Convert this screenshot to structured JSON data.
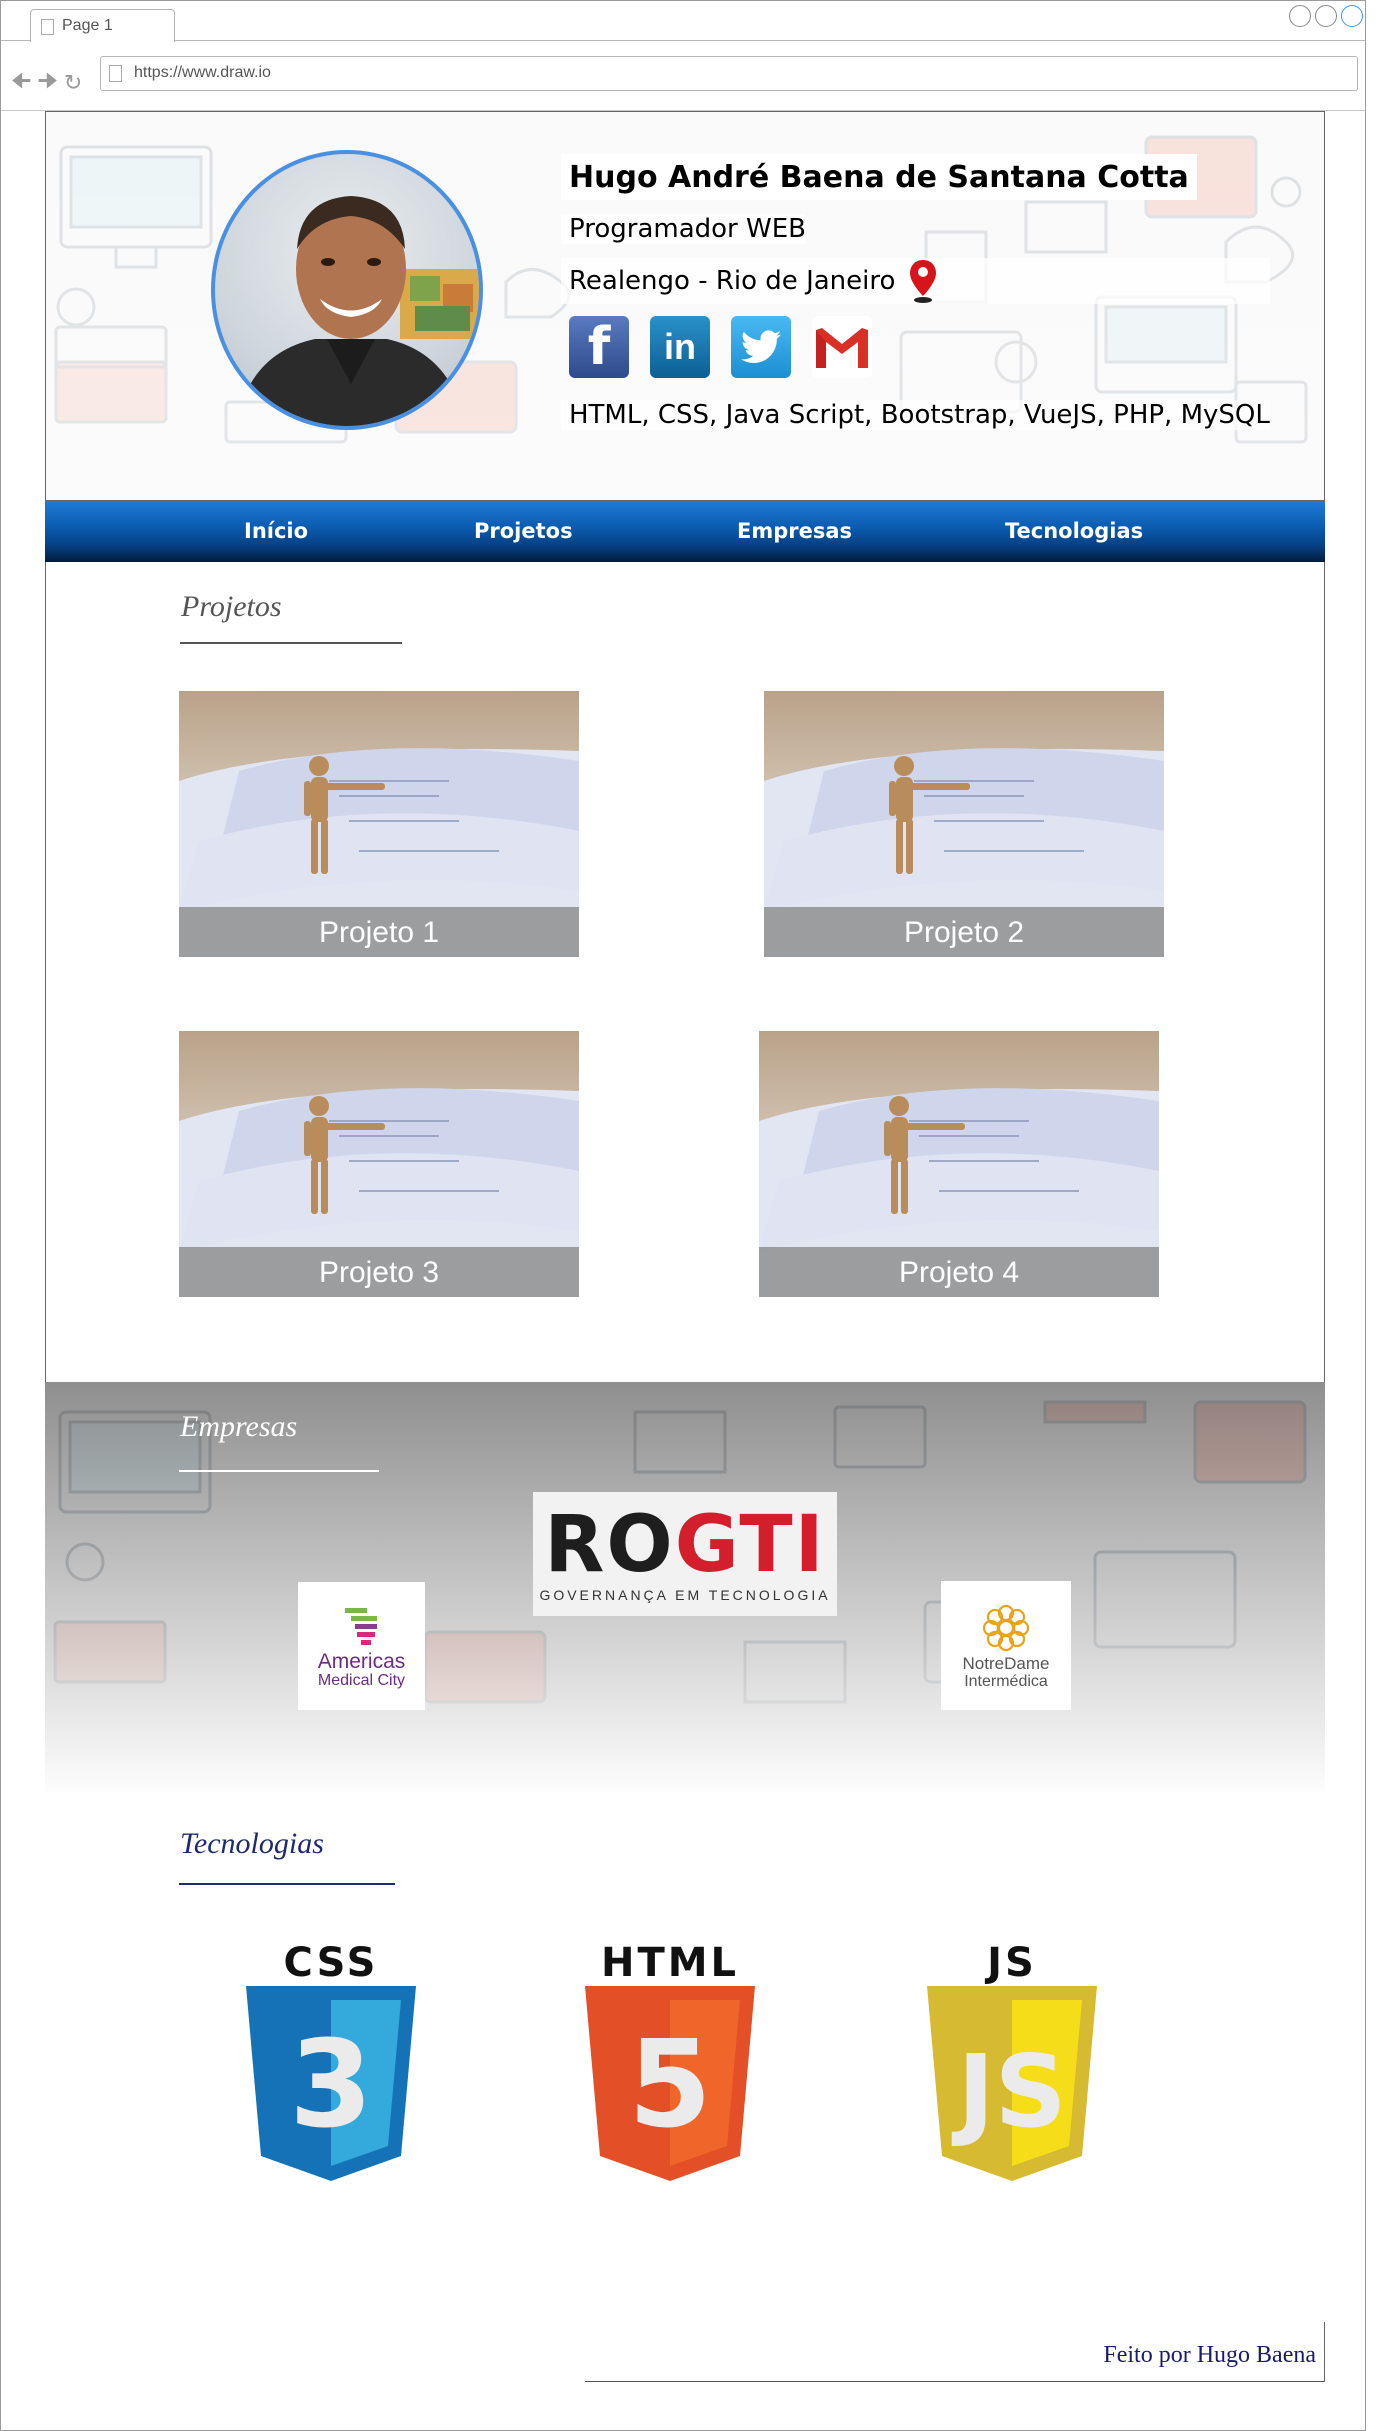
{
  "browser": {
    "tab_title": "Page 1",
    "url": "https://www.draw.io"
  },
  "profile": {
    "name": "Hugo André Baena de Santana Cotta",
    "role": "Programador WEB",
    "location": "Realengo - Rio de Janeiro",
    "skills": "HTML, CSS, Java Script, Bootstrap, VueJS, PHP, MySQL",
    "social": [
      {
        "icon": "facebook-icon",
        "color": "#3b5998"
      },
      {
        "icon": "linkedin-icon",
        "color": "#0e76a8"
      },
      {
        "icon": "twitter-icon",
        "color": "#1da1f2"
      },
      {
        "icon": "gmail-icon",
        "color": "#d93025"
      }
    ]
  },
  "menu": {
    "items": [
      "Início",
      "Projetos",
      "Empresas",
      "Tecnologias"
    ],
    "colors": {
      "top": "#1f7bd6",
      "bottom": "#021b3c"
    }
  },
  "projects": {
    "title": "Projetos",
    "cards": [
      "Projeto 1",
      "Projeto 2",
      "Projeto 3",
      "Projeto 4"
    ]
  },
  "companies": {
    "title": "Empresas",
    "logos": [
      {
        "name": "ROGTI",
        "tagline": "GOVERNANÇA EM TECNOLOGIA"
      },
      {
        "name": "Americas",
        "sub": "Medical City"
      },
      {
        "name": "NotreDame",
        "sub": "Intermédica"
      }
    ]
  },
  "technologies": {
    "title": "Tecnologias",
    "items": [
      {
        "label": "CSS",
        "number": "3",
        "color": "#1572b6",
        "light": "#33a9dc"
      },
      {
        "label": "HTML",
        "number": "5",
        "color": "#e34f26",
        "light": "#ef652a"
      },
      {
        "label": "JS",
        "number": "JS",
        "color": "#d6ba32",
        "light": "#f5de19"
      }
    ]
  },
  "footer": {
    "text": "Feito por Hugo Baena"
  }
}
